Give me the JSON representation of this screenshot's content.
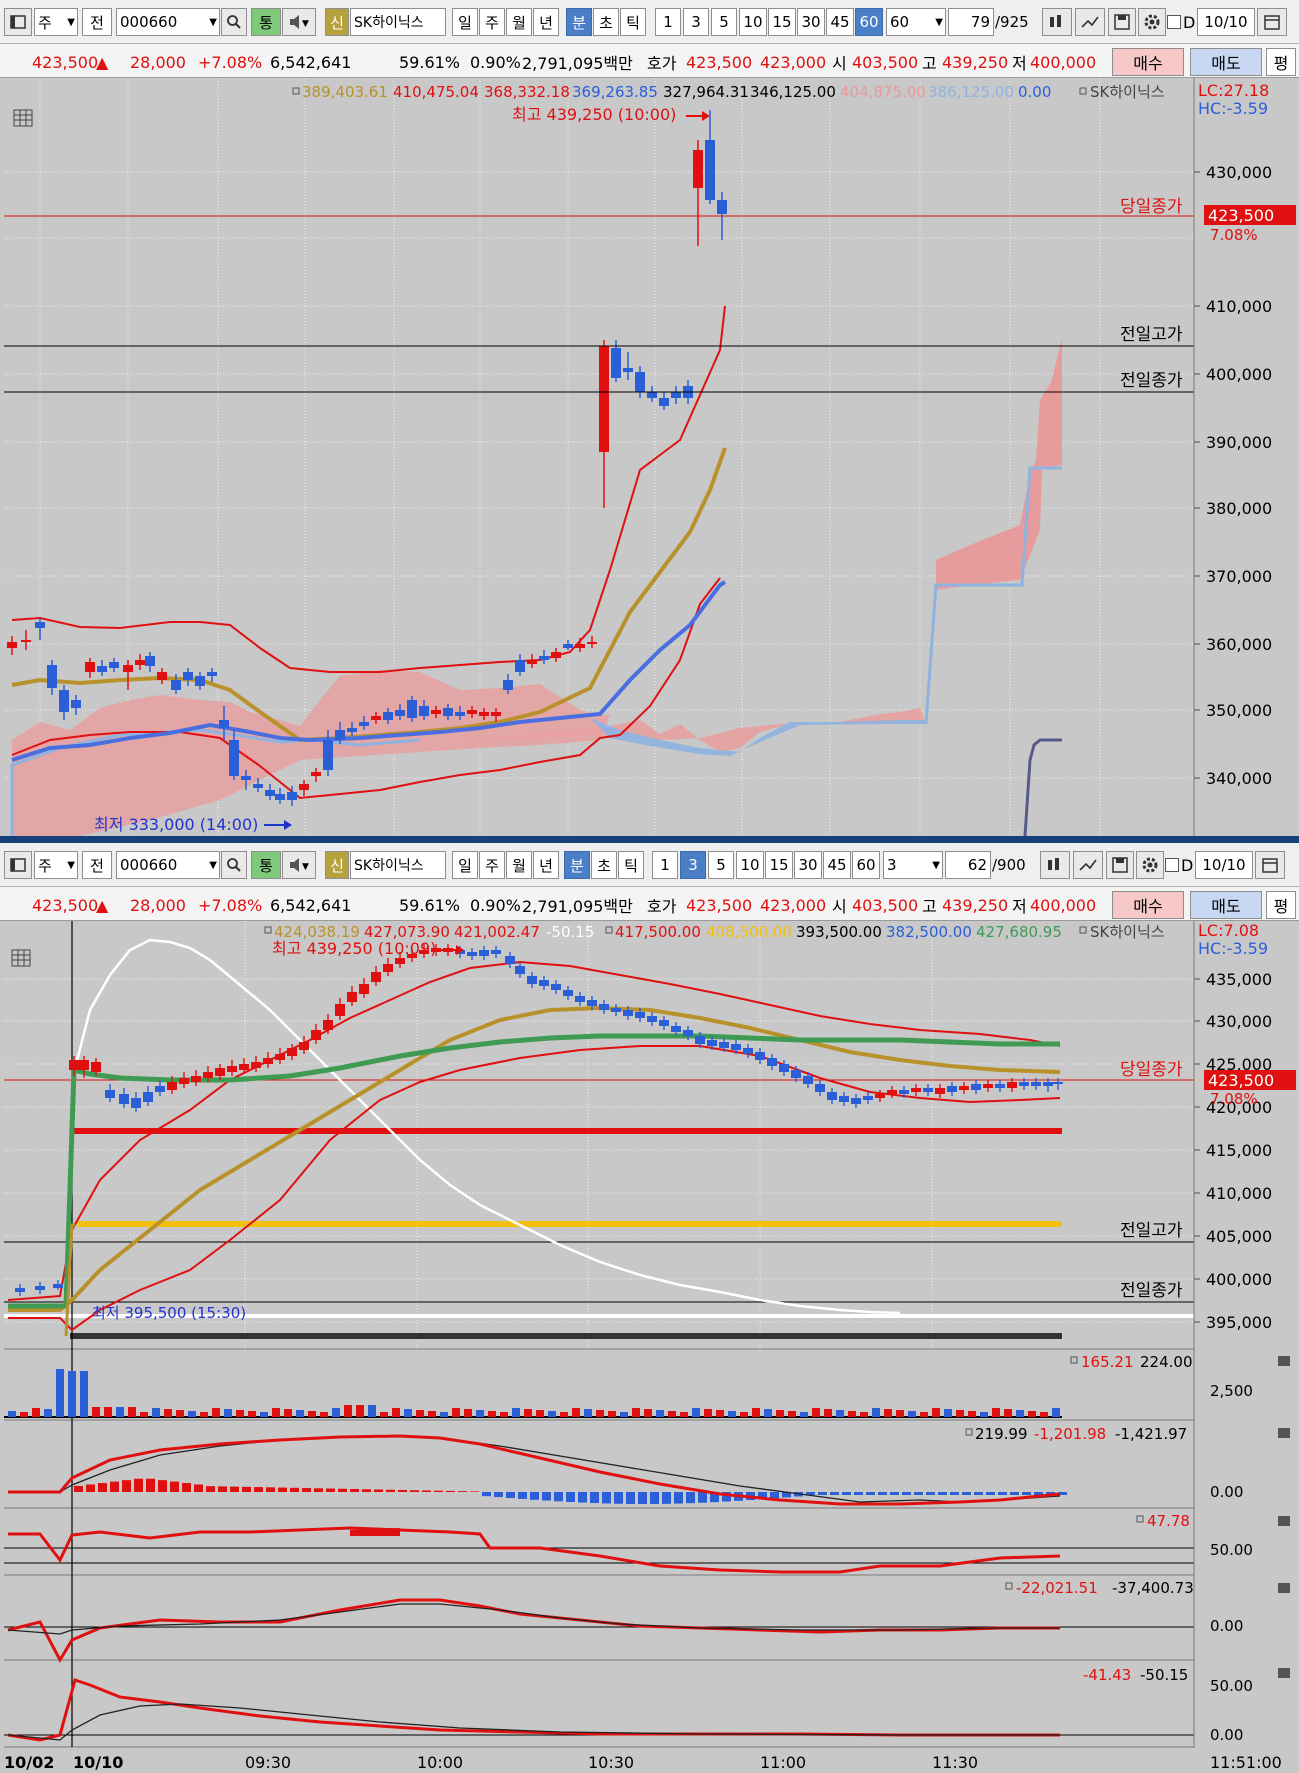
{
  "colors": {
    "up": "#e01010",
    "down": "#2a5fd8",
    "bg": "#c8c8c8",
    "accent": "#4a7ec6",
    "gold": "#b8912a",
    "green": "#3f9a54",
    "yellow": "#f2c010",
    "white": "#ffffff",
    "cloud_red": "#e89a9a",
    "cloud_blue": "#8fb3e0"
  },
  "icons": [
    "window-icon",
    "dropdown-icon",
    "search-icon",
    "speaker-icon",
    "bars-icon",
    "cursor-icon",
    "save-icon",
    "gear-icon",
    "calendar-icon",
    "grid-icon",
    "close-icon",
    "arrow-up-icon",
    "arrow-right-icon"
  ],
  "pane1": {
    "toolbar": {
      "type_label": "주",
      "prev_label": "전",
      "code": "000660",
      "tong_label": "통",
      "sin_label": "신",
      "stock_name": "SK하이닉스",
      "periods": [
        "일",
        "주",
        "월",
        "년",
        "분",
        "초",
        "틱"
      ],
      "minutes": [
        "1",
        "3",
        "5",
        "10",
        "15",
        "30",
        "45",
        "60"
      ],
      "selected_minute": "60",
      "interval_value": "60",
      "count": "79",
      "count_total": "/925",
      "d_label": "D",
      "date": "10/10"
    },
    "info": {
      "price": "423,500",
      "change": "28,000",
      "change_pct": "+7.08%",
      "volume": "6,542,641",
      "rate1": "59.61%",
      "rate2": "0.90%",
      "amount": "2,791,095백만",
      "hoga_label": "호가",
      "hoga1": "423,500",
      "hoga2": "423,000",
      "open_label": "시",
      "open": "403,500",
      "high_label": "고",
      "high": "439,250",
      "low_label": "저",
      "low": "400,000",
      "buy": "매수",
      "sell": "매도",
      "flat": "평"
    },
    "legend": {
      "v1": "389,403.61",
      "v2": "410,475.04",
      "v3": "368,332.18",
      "v4": "369,263.85",
      "v5": "327,964.31",
      "v6": "346,125.00",
      "v7": "404,875.00",
      "v8": "386,125.00",
      "v9": "0.00",
      "name": "SK하이닉스"
    },
    "lc": "LC:27.18",
    "hc": "HC:-3.59",
    "high_note": "최고 439,250 (10:00)",
    "low_note": "최저 333,000 (14:00)",
    "day_close": "당일종가",
    "prev_high": "전일고가",
    "prev_close": "전일종가",
    "price_tag": "423,500",
    "price_pct": "7.08%",
    "axis": [
      "430,000",
      "410,000",
      "400,000",
      "390,000",
      "380,000",
      "370,000",
      "360,000",
      "350,000",
      "340,000"
    ]
  },
  "pane2": {
    "toolbar": {
      "type_label": "주",
      "prev_label": "전",
      "code": "000660",
      "tong_label": "통",
      "sin_label": "신",
      "stock_name": "SK하이닉스",
      "periods": [
        "일",
        "주",
        "월",
        "년",
        "분",
        "초",
        "틱"
      ],
      "minutes": [
        "1",
        "3",
        "5",
        "10",
        "15",
        "30",
        "45",
        "60"
      ],
      "selected_minute": "3",
      "interval_value": "3",
      "count": "62",
      "count_total": "/900",
      "d_label": "D",
      "date": "10/10"
    },
    "info": {
      "price": "423,500",
      "change": "28,000",
      "change_pct": "+7.08%",
      "volume": "6,542,641",
      "rate1": "59.61%",
      "rate2": "0.90%",
      "amount": "2,791,095백만",
      "hoga_label": "호가",
      "hoga1": "423,500",
      "hoga2": "423,000",
      "open_label": "시",
      "open": "403,500",
      "high_label": "고",
      "high": "439,250",
      "low_label": "저",
      "low": "400,000",
      "buy": "매수",
      "sell": "매도",
      "flat": "평"
    },
    "legend": {
      "v1": "424,038.19",
      "v2": "427,073.90",
      "v3": "421,002.47",
      "v4": "-50.15",
      "v5": "417,500.00",
      "v6": "408,500.00",
      "v7": "393,500.00",
      "v8": "382,500.00",
      "v9": "427,680.95",
      "name": "SK하이닉스"
    },
    "lc": "LC:7.08",
    "hc": "HC:-3.59",
    "high_note": "최고 439,250 (10:09)",
    "low_note": "최저 395,500 (15:30)",
    "day_close": "당일종가",
    "prev_high": "전일고가",
    "prev_close": "전일종가",
    "price_tag": "423,500",
    "price_pct": "7.08%",
    "axis": [
      "435,000",
      "430,000",
      "425,000",
      "420,000",
      "415,000",
      "410,000",
      "405,000",
      "400,000",
      "395,000"
    ],
    "sub1": {
      "v1": "165.21",
      "v2": "224.00",
      "axis": "2,500"
    },
    "sub2": {
      "v1": "219.99",
      "v2": "-1,201.98",
      "v3": "-1,421.97",
      "axis": "0.00"
    },
    "sub3": {
      "v1": "47.78",
      "axis": "50.00"
    },
    "sub4": {
      "v1": "-22,021.51",
      "v2": "-37,400.73",
      "axis": "0.00"
    },
    "sub5": {
      "v1": "-41.43",
      "v2": "-50.15",
      "axis1": "50.00",
      "axis2": "0.00"
    },
    "xaxis": [
      "10/02",
      "10/10",
      "09:30",
      "10:00",
      "10:30",
      "11:00",
      "11:30"
    ],
    "clock": "11:51:00"
  }
}
